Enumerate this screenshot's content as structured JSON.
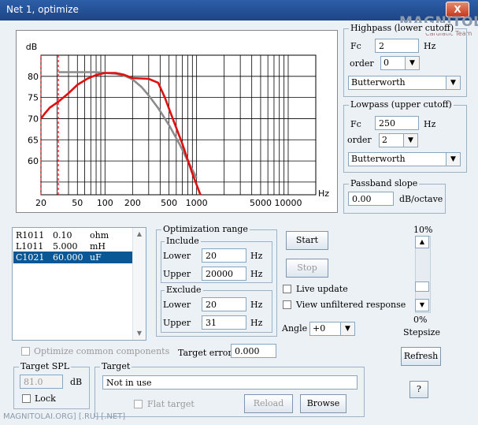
{
  "window": {
    "title": "Net 1, optimize",
    "close_label": "X"
  },
  "watermark": {
    "brand": "MAGNITOLA",
    "team": "Cardiatic Team",
    "footer": "MAGNITOLAI.ORG] [.RU] [.NET]"
  },
  "chart_data": {
    "type": "line",
    "ylabel": "dB",
    "xunit": "Hz",
    "xscale": "log",
    "xlim": [
      20,
      20000
    ],
    "ylim": [
      52,
      85
    ],
    "yticks": [
      80,
      75,
      70,
      65,
      60
    ],
    "xticks": [
      20,
      50,
      100,
      200,
      500,
      1000,
      5000,
      10000
    ],
    "markers": [
      31
    ],
    "grid": true,
    "series": [
      {
        "color": "#e01010",
        "x": [
          20,
          22,
          25,
          31,
          40,
          50,
          65,
          80,
          100,
          130,
          160,
          200,
          300,
          380,
          450,
          550,
          700,
          900,
          1100
        ],
        "y": [
          70,
          71.2,
          72.6,
          74,
          76,
          78,
          79.5,
          80.3,
          80.8,
          80.8,
          80.4,
          79.6,
          79.4,
          78.5,
          75,
          70,
          64,
          57,
          52
        ]
      },
      {
        "color": "#8c8c8c",
        "x": [
          31,
          40,
          60,
          80,
          100,
          130,
          160,
          200,
          250,
          300,
          380,
          500,
          650,
          800,
          1000
        ],
        "y": [
          81,
          81,
          81,
          81,
          80.8,
          80.6,
          80.2,
          79.3,
          77.5,
          75.5,
          72.5,
          68.5,
          64,
          60,
          56
        ]
      }
    ]
  },
  "highpass": {
    "title": "Highpass (lower cutoff)",
    "fc_label": "Fc",
    "fc_value": "2",
    "fc_unit": "Hz",
    "order_label": "order",
    "order_value": "0",
    "type_value": "Butterworth"
  },
  "lowpass": {
    "title": "Lowpass (upper cutoff)",
    "fc_label": "Fc",
    "fc_value": "250",
    "fc_unit": "Hz",
    "order_label": "order",
    "order_value": "2",
    "type_value": "Butterworth"
  },
  "passband": {
    "title": "Passband slope",
    "value": "0.00",
    "unit": "dB/octave"
  },
  "components": [
    {
      "name": "R1011",
      "value": "0.10",
      "unit": "ohm",
      "selected": false
    },
    {
      "name": "L1011",
      "value": "5.000",
      "unit": "mH",
      "selected": false
    },
    {
      "name": "C1021",
      "value": "60.000",
      "unit": "uF",
      "selected": true
    }
  ],
  "optimization": {
    "title": "Optimization range",
    "include": {
      "title": "Include",
      "lower_label": "Lower",
      "lower_value": "20",
      "upper_label": "Upper",
      "upper_value": "20000",
      "unit": "Hz"
    },
    "exclude": {
      "title": "Exclude",
      "lower_label": "Lower",
      "lower_value": "20",
      "upper_label": "Upper",
      "upper_value": "31",
      "unit": "Hz"
    }
  },
  "actions": {
    "start": "Start",
    "stop": "Stop",
    "refresh": "Refresh",
    "help": "?",
    "reload": "Reload",
    "browse": "Browse"
  },
  "options": {
    "live_update": "Live update",
    "view_unfiltered": "View unfiltered response",
    "angle_label": "Angle",
    "angle_value": "+0"
  },
  "stepsize": {
    "top": "10%",
    "bottom": "0%",
    "label": "Stepsize"
  },
  "optimize_common": "Optimize common components",
  "target_error": {
    "label": "Target error",
    "value": "0.000"
  },
  "target_spl": {
    "title": "Target SPL",
    "value": "81.0",
    "unit": "dB",
    "lock_label": "Lock"
  },
  "target": {
    "title": "Target",
    "value": "Not in use",
    "flat_label": "Flat target"
  }
}
